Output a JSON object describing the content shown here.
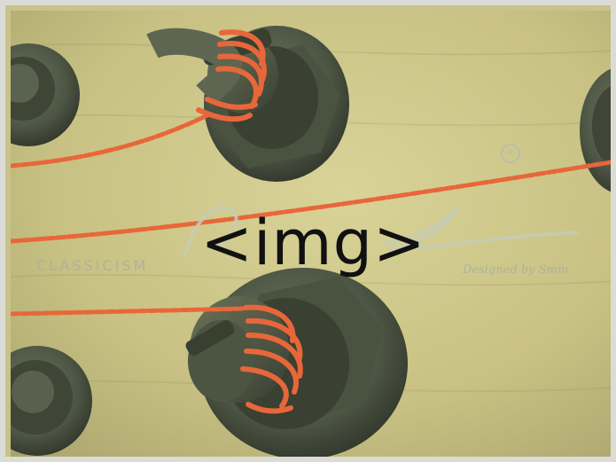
{
  "placeholder": {
    "label": "<img>"
  },
  "headstock": {
    "inlay_left": "CLASSICISM",
    "inlay_right": "Designed by Smm",
    "registered_mark": "R"
  },
  "colors": {
    "wood": "#c9c28a",
    "peg_metal": "#4a5240",
    "string": "#e8673a",
    "frame": "#dcdcd6"
  }
}
